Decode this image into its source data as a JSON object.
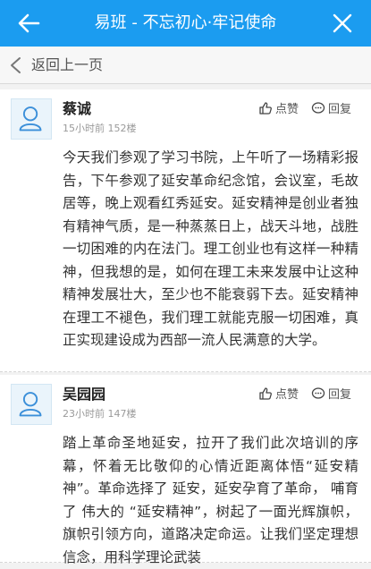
{
  "appbar": {
    "title": "易班 - 不忘初心·牢记使命",
    "back_icon": "arrow-left-icon",
    "close_icon": "close-icon",
    "background": "#1b9cf0"
  },
  "subnav": {
    "label": "返回上一页",
    "icon": "chevron-left-icon"
  },
  "posts": [
    {
      "author": "蔡诚",
      "meta": "15小时前 152楼",
      "like_label": "点赞",
      "reply_label": "回复",
      "content": "今天我们参观了学习书院，上午听了一场精彩报告，下午参观了延安革命纪念馆，会议室，毛故居等，晚上观看红秀延安。延安精神是创业者独有精神气质，是一种蒸蒸日上，战天斗地，战胜一切困难的内在法门。理工创业也有这样一种精神，但我想的是，如何在理工未来发展中让这种精神发展壮大，至少也不能衰弱下去。延安精神在理工不褪色，我们理工就能克服一切困难，真正实现建设成为西部一流人民满意的大学。"
    },
    {
      "author": "吴园园",
      "meta": "23小时前 147楼",
      "like_label": "点赞",
      "reply_label": "回复",
      "content": "踏上革命圣地延安，拉开了我们此次培训的序幕，怀着无比敬仰的心情近距离体悟“延安精神”。革命选择了 延安，延安孕育了革命， 哺育了 伟大的 “延安精神”，树起了一面光辉旗帜，旗帜引领方向，道路决定命运。让我们坚定理想信念，用科学理论武装"
    }
  ]
}
